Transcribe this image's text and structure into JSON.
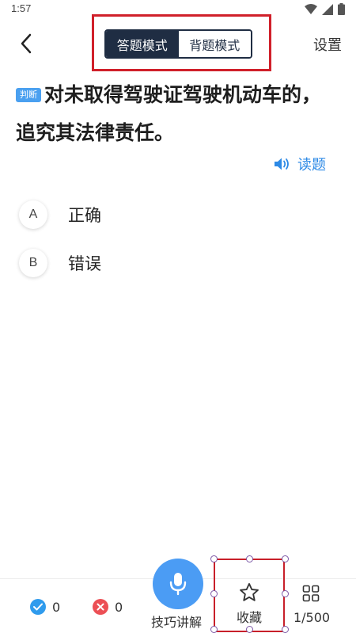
{
  "status_bar": {
    "time": "1:57"
  },
  "header": {
    "modes": [
      {
        "label": "答题模式",
        "active": true
      },
      {
        "label": "背题模式",
        "active": false
      }
    ],
    "settings_label": "设置"
  },
  "question": {
    "type_badge": "判断",
    "text": "对未取得驾驶证驾驶机动车的，追究其法律责任。"
  },
  "read_aloud_label": "读题",
  "options": [
    {
      "letter": "A",
      "text": "正确"
    },
    {
      "letter": "B",
      "text": "错误"
    }
  ],
  "bottom_bar": {
    "correct_count": "0",
    "wrong_count": "0",
    "skill_label": "技巧讲解",
    "favorite_label": "收藏",
    "progress": "1/500"
  },
  "colors": {
    "accent": "#2d8ae6",
    "dark_navy": "#1f2d43",
    "mic_blue": "#4b9cf4",
    "correct_blue": "#2f9bed",
    "wrong_red": "#ec4f55",
    "highlight_red": "#d0202a"
  },
  "icons": {
    "back": "chevron-left-icon",
    "speaker": "speaker-icon",
    "mic": "microphone-icon",
    "favorite": "star-icon",
    "grid": "grid-icon"
  }
}
